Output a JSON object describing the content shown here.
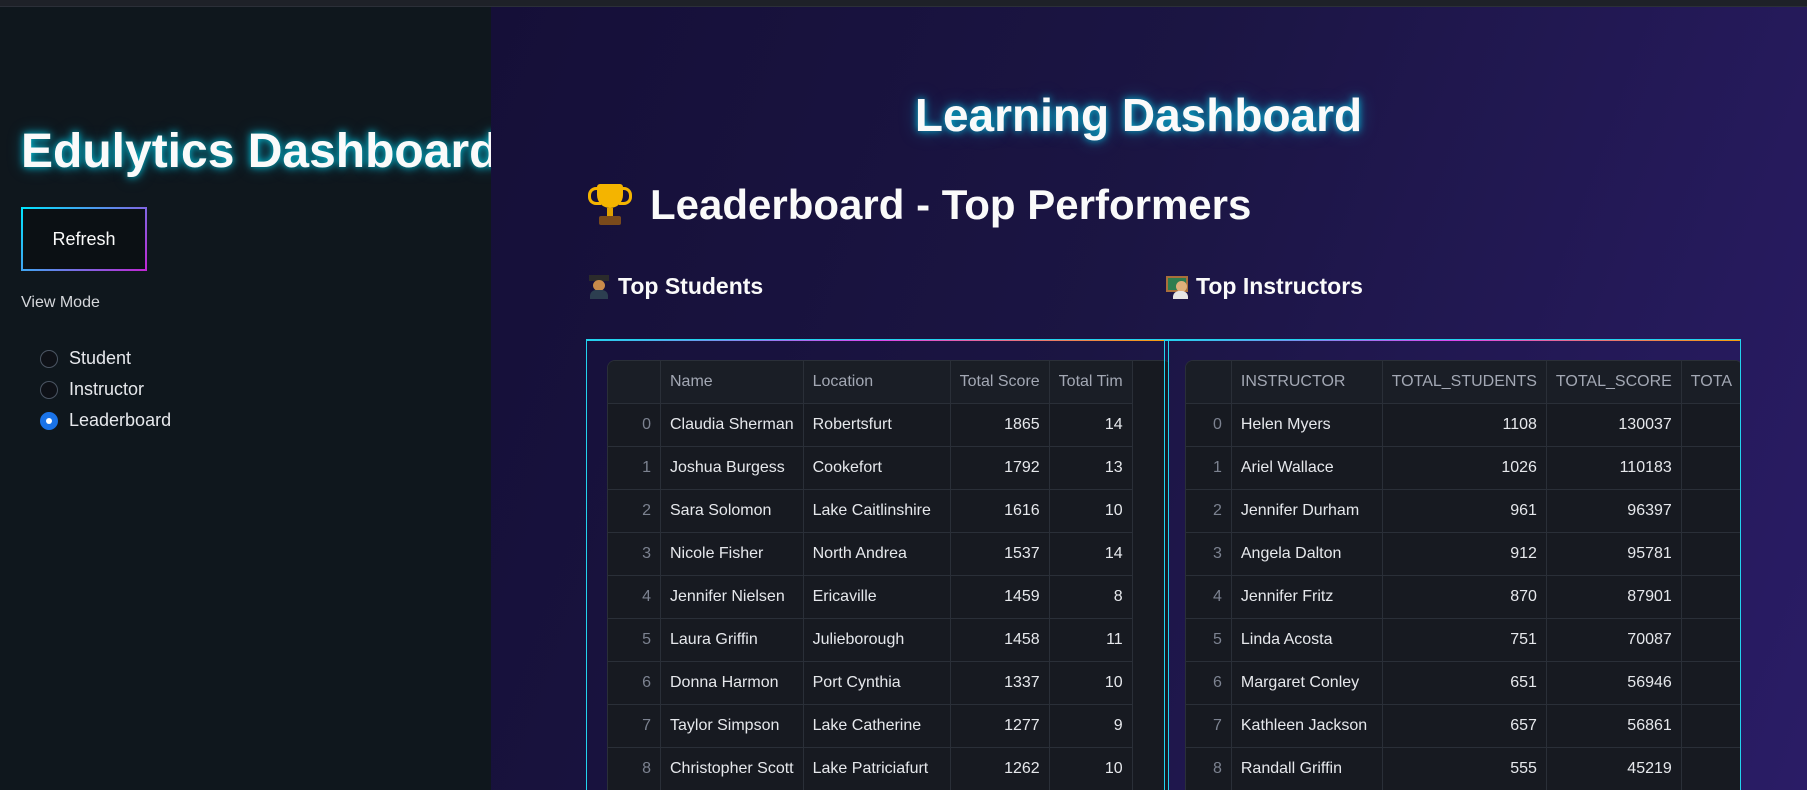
{
  "sidebar": {
    "title": "Edulytics Dashboard",
    "refresh_label": "Refresh",
    "view_mode_label": "View Mode",
    "view_modes": [
      {
        "label": "Student",
        "selected": false
      },
      {
        "label": "Instructor",
        "selected": false
      },
      {
        "label": "Leaderboard",
        "selected": true
      }
    ]
  },
  "main": {
    "title": "Learning Dashboard",
    "leaderboard_heading": "Leaderboard - Top Performers",
    "students_heading": "Top Students",
    "instructors_heading": "Top Instructors"
  },
  "students_table": {
    "columns": [
      "",
      "Name",
      "Location",
      "Total Score",
      "Total Tim"
    ],
    "rows": [
      [
        "0",
        "Claudia Sherman",
        "Robertsfurt",
        "1865",
        "14"
      ],
      [
        "1",
        "Joshua Burgess",
        "Cookefort",
        "1792",
        "13"
      ],
      [
        "2",
        "Sara Solomon",
        "Lake Caitlinshire",
        "1616",
        "10"
      ],
      [
        "3",
        "Nicole Fisher",
        "North Andrea",
        "1537",
        "14"
      ],
      [
        "4",
        "Jennifer Nielsen",
        "Ericaville",
        "1459",
        "8"
      ],
      [
        "5",
        "Laura Griffin",
        "Julieborough",
        "1458",
        "11"
      ],
      [
        "6",
        "Donna Harmon",
        "Port Cynthia",
        "1337",
        "10"
      ],
      [
        "7",
        "Taylor Simpson",
        "Lake Catherine",
        "1277",
        "9"
      ],
      [
        "8",
        "Christopher Scott",
        "Lake Patriciafurt",
        "1262",
        "10"
      ]
    ]
  },
  "instructors_table": {
    "columns": [
      "",
      "INSTRUCTOR",
      "TOTAL_STUDENTS",
      "TOTAL_SCORE",
      "TOTA"
    ],
    "rows": [
      [
        "0",
        "Helen Myers",
        "1108",
        "130037",
        ""
      ],
      [
        "1",
        "Ariel Wallace",
        "1026",
        "110183",
        ""
      ],
      [
        "2",
        "Jennifer Durham",
        "961",
        "96397",
        ""
      ],
      [
        "3",
        "Angela Dalton",
        "912",
        "95781",
        ""
      ],
      [
        "4",
        "Jennifer Fritz",
        "870",
        "87901",
        ""
      ],
      [
        "5",
        "Linda Acosta",
        "751",
        "70087",
        ""
      ],
      [
        "6",
        "Margaret Conley",
        "651",
        "56946",
        ""
      ],
      [
        "7",
        "Kathleen Jackson",
        "657",
        "56861",
        ""
      ],
      [
        "8",
        "Randall Griffin",
        "555",
        "45219",
        ""
      ]
    ]
  }
}
